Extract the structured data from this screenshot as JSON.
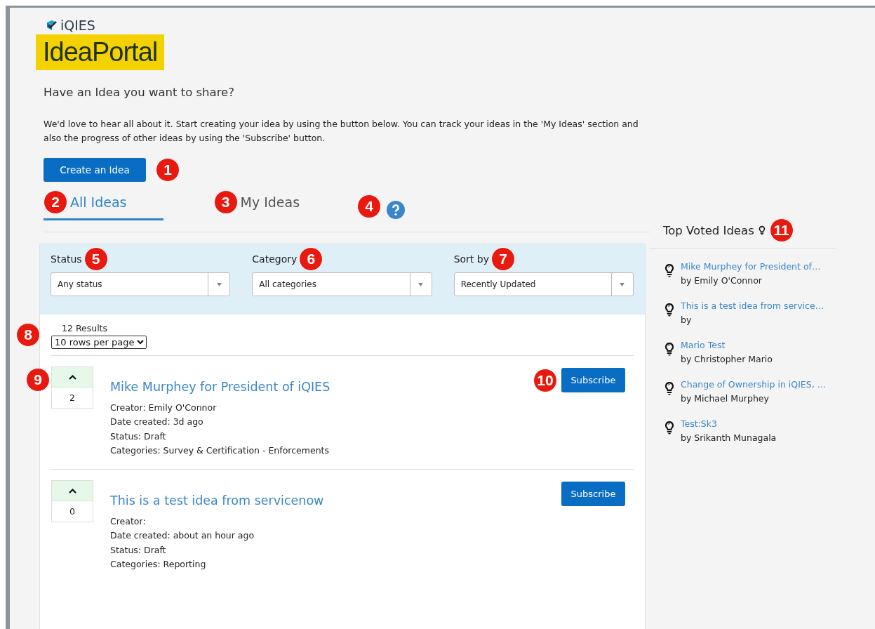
{
  "header": {
    "brand": "iQIES",
    "portal_title": "IdeaPortal",
    "heading": "Have an Idea you want to share?",
    "intro": "We'd love to hear all about it. Start creating your idea by using the button below. You can track your ideas in the 'My Ideas' section and also the progress of other ideas by using the 'Subscribe' button.",
    "create_button": {
      "label": "Create an Idea",
      "callout": "1"
    }
  },
  "tabs": [
    {
      "label": "All Ideas",
      "selected": true,
      "callout": "2"
    },
    {
      "label": "My Ideas",
      "selected": false,
      "callout": "3"
    }
  ],
  "help_callout": "4",
  "filters": [
    {
      "label": "Status",
      "value": "Any status",
      "callout": "5"
    },
    {
      "label": "Category",
      "value": "All categories",
      "callout": "6"
    },
    {
      "label": "Sort by",
      "value": "Recently Updated",
      "callout": "7"
    }
  ],
  "results": {
    "count": "12 Results",
    "rows_per_page": "10 rows per page",
    "callout": "8"
  },
  "ideas": [
    {
      "votes": "2",
      "title": "Mike Murphey for President of iQIES",
      "details": [
        "Creator: Emily O'Connor",
        "Date created: 3d ago",
        "Status: Draft",
        "Categories: Survey & Certification - Enforcements"
      ],
      "subscribe": "Subscribe",
      "vote_callout": "9",
      "subscribe_callout": "10"
    },
    {
      "votes": "0",
      "title": "This is a test idea from servicenow",
      "details": [
        "Creator:",
        "Date created: about an hour ago",
        "Status: Draft",
        "Categories: Reporting"
      ],
      "subscribe": "Subscribe"
    }
  ],
  "top_voted": {
    "title": "Top Voted Ideas",
    "callout": "11",
    "items": [
      {
        "title": "Mike Murphey for President of…",
        "author": "by Emily O'Connor"
      },
      {
        "title": "This is a test idea from service…",
        "author": "by"
      },
      {
        "title": "Mario Test",
        "author": "by Christopher Mario"
      },
      {
        "title": "Change of Ownership in iQIES, …",
        "author": "by Michael Murphey"
      },
      {
        "title": "Test:Sk3",
        "author": "by Srikanth Munagala"
      }
    ]
  }
}
